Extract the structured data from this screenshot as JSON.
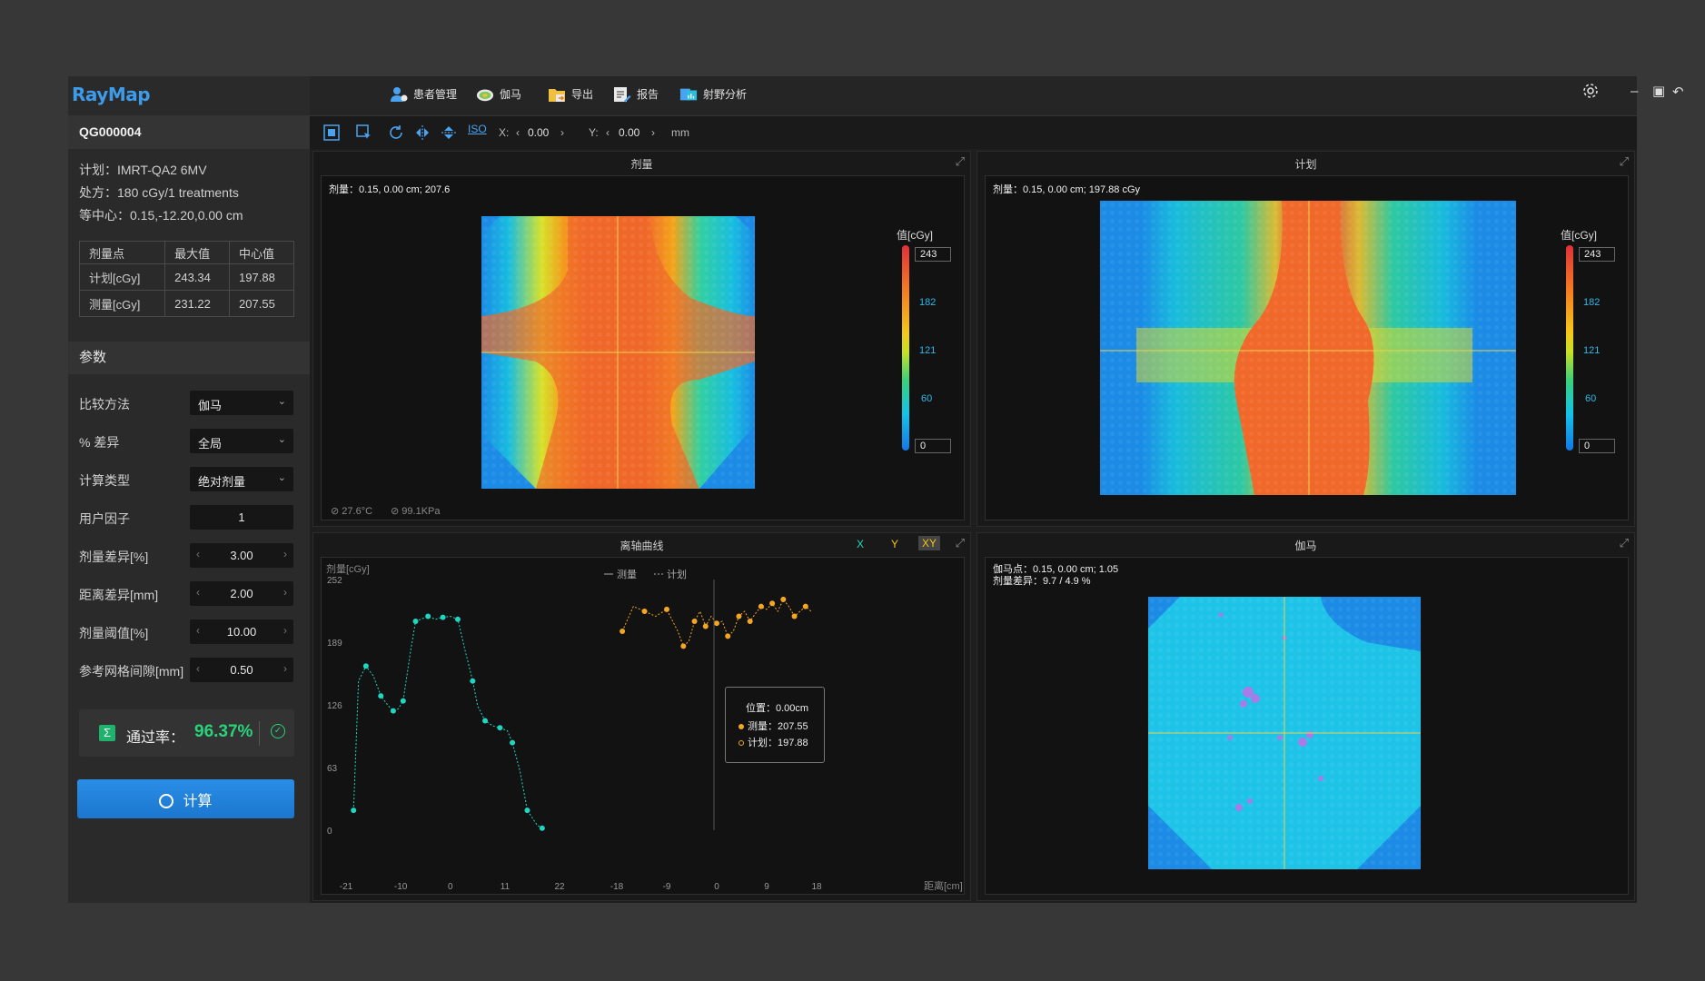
{
  "app": {
    "logo": "RayMap",
    "patient_id": "QG000004"
  },
  "plan_info": {
    "plan": "计划：IMRT-QA2 6MV",
    "prescription": "处方：180 cGy/1 treatments",
    "isocenter": "等中心：0.15,-12.20,0.00 cm"
  },
  "dose_table": {
    "headers": [
      "剂量点",
      "最大值",
      "中心值"
    ],
    "rows": [
      [
        "计划[cGy]",
        "243.34",
        "197.88"
      ],
      [
        "测量[cGy]",
        "231.22",
        "207.55"
      ]
    ]
  },
  "params": {
    "title": "参数",
    "compare_method": {
      "label": "比较方法",
      "value": "伽马"
    },
    "percent_diff": {
      "label": "% 差异",
      "value": "全局"
    },
    "calc_type": {
      "label": "计算类型",
      "value": "绝对剂量"
    },
    "user_factor": {
      "label": "用户因子",
      "value": "1"
    },
    "dose_diff": {
      "label": "剂量差异[%]",
      "value": "3.00"
    },
    "dist_diff": {
      "label": "距离差异[mm]",
      "value": "2.00"
    },
    "dose_threshold": {
      "label": "剂量阈值[%]",
      "value": "10.00"
    },
    "grid_spacing": {
      "label": "参考网格间隙[mm]",
      "value": "0.50"
    }
  },
  "pass_rate": {
    "label": "通过率：",
    "value": "96.37%"
  },
  "calc_button": "计算",
  "menu": [
    "患者管理",
    "伽马",
    "导出",
    "报告",
    "射野分析"
  ],
  "toolbar": {
    "x_label": "X:",
    "x_value": "0.00",
    "y_label": "Y:",
    "y_value": "0.00",
    "unit": "mm",
    "iso_label": "ISO"
  },
  "panels": {
    "measured": {
      "title": "剂量",
      "readout": "剂量：0.15, 0.00 cm; 207.6",
      "temperature": "27.6°C",
      "pressure": "99.1KPa",
      "colorbar_title": "值[cGy]",
      "colorbar_max": "243",
      "colorbar_min": "0",
      "colorbar_ticks": [
        "182",
        "121",
        "60"
      ]
    },
    "planned": {
      "title": "计划",
      "readout": "剂量：0.15, 0.00 cm; 197.88 cGy",
      "colorbar_title": "值[cGy]",
      "colorbar_max": "243",
      "colorbar_min": "0",
      "colorbar_ticks": [
        "182",
        "121",
        "60"
      ]
    },
    "profile": {
      "title": "离轴曲线",
      "axis_buttons": [
        "X",
        "Y",
        "XY"
      ],
      "tooltip": {
        "position": "位置：0.00cm",
        "measured": "测量：207.55",
        "planned": "计划：197.88"
      }
    },
    "gamma": {
      "title": "伽马",
      "readout_line1": "伽马点：0.15, 0.00 cm; 1.05",
      "readout_line2": "剂量差异：9.7  / 4.9 %"
    }
  },
  "colors": {
    "accent": "#1b76cf",
    "measured_series": "#1fd6c0",
    "planned_series": "#f5a623",
    "crosshair": "#e8d24a",
    "pass": "#2ad27a"
  },
  "chart_data": {
    "type": "line",
    "ylabel": "剂量[cGy]",
    "xlabel": "距离[cm]",
    "ylim": [
      0,
      252
    ],
    "y_ticks": [
      0,
      63,
      126,
      189,
      252
    ],
    "legend": [
      "测量",
      "计划"
    ],
    "series": [
      {
        "name": "测量",
        "axis": "X",
        "x_ticks": [
          -21,
          -10,
          0,
          11,
          22
        ],
        "xlim": [
          -21,
          22
        ],
        "x": [
          -19.5,
          -18.5,
          -17,
          -15.5,
          -14,
          -12.5,
          -11.5,
          -10.5,
          -9.5,
          -8,
          -7,
          -6,
          -4.5,
          -3,
          -1.5,
          0,
          1.5,
          3,
          4.5,
          5.5,
          7,
          8.5,
          10,
          11.5,
          12.5,
          14,
          15.5,
          17.5,
          18.5
        ],
        "values": [
          20,
          150,
          165,
          155,
          135,
          125,
          120,
          122,
          130,
          180,
          210,
          212,
          215,
          212,
          214,
          215,
          212,
          180,
          150,
          125,
          110,
          105,
          103,
          100,
          88,
          60,
          20,
          5,
          2
        ]
      },
      {
        "name": "计划",
        "axis": "Y",
        "x_ticks": [
          -18,
          -9,
          0,
          9,
          18
        ],
        "xlim": [
          -18,
          18
        ],
        "x": [
          -17,
          -15,
          -13,
          -11,
          -9,
          -7,
          -6,
          -5,
          -4,
          -3,
          -2,
          -1,
          0,
          1,
          2,
          3,
          4,
          5,
          6,
          7,
          8,
          9,
          10,
          11,
          12,
          13,
          14,
          15,
          16,
          17
        ],
        "values": [
          200,
          225,
          220,
          215,
          222,
          200,
          185,
          190,
          210,
          220,
          205,
          215,
          208,
          210,
          195,
          200,
          215,
          220,
          210,
          218,
          225,
          222,
          228,
          220,
          232,
          225,
          215,
          220,
          225,
          220
        ]
      }
    ]
  }
}
